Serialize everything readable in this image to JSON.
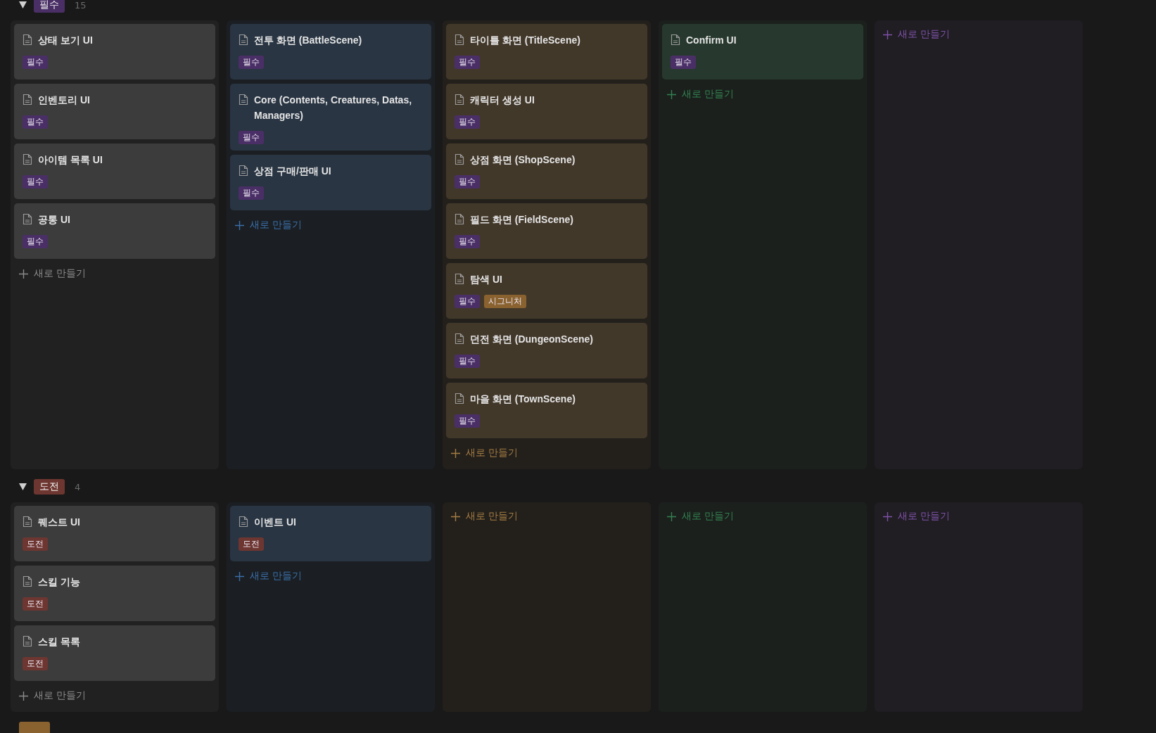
{
  "groups": [
    {
      "tag": {
        "label": "필수",
        "color": "#4a2f66"
      },
      "count": "15",
      "expanded": true,
      "columns": [
        {
          "color": "#8c8c8c",
          "cards": [
            {
              "title": "상태 보기 UI",
              "tags": [
                {
                  "label": "필수",
                  "color": "#4a2f66"
                }
              ]
            },
            {
              "title": "인벤토리 UI",
              "tags": [
                {
                  "label": "필수",
                  "color": "#4a2f66"
                }
              ]
            },
            {
              "title": "아이템 목록 UI",
              "tags": [
                {
                  "label": "필수",
                  "color": "#4a2f66"
                }
              ]
            },
            {
              "title": "공통 UI",
              "tags": [
                {
                  "label": "필수",
                  "color": "#4a2f66"
                }
              ]
            }
          ],
          "new_label": "새로 만들기"
        },
        {
          "color": "#3a6ea8",
          "cards": [
            {
              "title": "전투 화면 (BattleScene)",
              "tags": [
                {
                  "label": "필수",
                  "color": "#4a2f66"
                }
              ]
            },
            {
              "title": "Core (Contents, Creatures, Datas, Managers)",
              "tags": [
                {
                  "label": "필수",
                  "color": "#4a2f66"
                }
              ]
            },
            {
              "title": "상점 구매/판매 UI",
              "tags": [
                {
                  "label": "필수",
                  "color": "#4a2f66"
                }
              ]
            }
          ],
          "new_label": "새로 만들기"
        },
        {
          "color": "#a57c42",
          "cards": [
            {
              "title": "타이틀 화면 (TitleScene)",
              "tags": [
                {
                  "label": "필수",
                  "color": "#4a2f66"
                }
              ]
            },
            {
              "title": "캐릭터 생성 UI",
              "tags": [
                {
                  "label": "필수",
                  "color": "#4a2f66"
                }
              ]
            },
            {
              "title": "상점 화면 (ShopScene)",
              "tags": [
                {
                  "label": "필수",
                  "color": "#4a2f66"
                }
              ]
            },
            {
              "title": "필드 화면 (FieldScene)",
              "tags": [
                {
                  "label": "필수",
                  "color": "#4a2f66"
                }
              ]
            },
            {
              "title": "탐색 UI",
              "tags": [
                {
                  "label": "필수",
                  "color": "#4a2f66"
                },
                {
                  "label": "시그니처",
                  "color": "#8a6230"
                }
              ]
            },
            {
              "title": "던전 화면 (DungeonScene)",
              "tags": [
                {
                  "label": "필수",
                  "color": "#4a2f66"
                }
              ]
            },
            {
              "title": "마을 화면 (TownScene)",
              "tags": [
                {
                  "label": "필수",
                  "color": "#4a2f66"
                }
              ]
            }
          ],
          "new_label": "새로 만들기"
        },
        {
          "color": "#33804f",
          "cards": [
            {
              "title": "Confirm UI",
              "tags": [
                {
                  "label": "필수",
                  "color": "#4a2f66"
                }
              ]
            }
          ],
          "new_label": "새로 만들기"
        },
        {
          "color": "#7e52a8",
          "new_label": "새로 만들기"
        }
      ]
    },
    {
      "tag": {
        "label": "도전",
        "color": "#6e3630"
      },
      "count": "4",
      "expanded": true,
      "columns": [
        {
          "color": "#8c8c8c",
          "cards": [
            {
              "title": "퀘스트 UI",
              "tags": [
                {
                  "label": "도전",
                  "color": "#6e3630"
                }
              ]
            },
            {
              "title": "스킬 기능",
              "tags": [
                {
                  "label": "도전",
                  "color": "#6e3630"
                }
              ]
            },
            {
              "title": "스킬 목록",
              "tags": [
                {
                  "label": "도전",
                  "color": "#6e3630"
                }
              ]
            }
          ],
          "new_label": "새로 만들기"
        },
        {
          "color": "#3a6ea8",
          "cards": [
            {
              "title": "이벤트 UI",
              "tags": [
                {
                  "label": "도전",
                  "color": "#6e3630"
                }
              ]
            }
          ],
          "new_label": "새로 만들기"
        },
        {
          "color": "#a57c42",
          "new_label": "새로 만들기"
        },
        {
          "color": "#33804f",
          "new_label": "새로 만들기"
        },
        {
          "color": "#7e52a8",
          "new_label": "새로 만들기"
        }
      ]
    },
    {
      "tag": {
        "color": "#8a6230"
      }
    }
  ]
}
